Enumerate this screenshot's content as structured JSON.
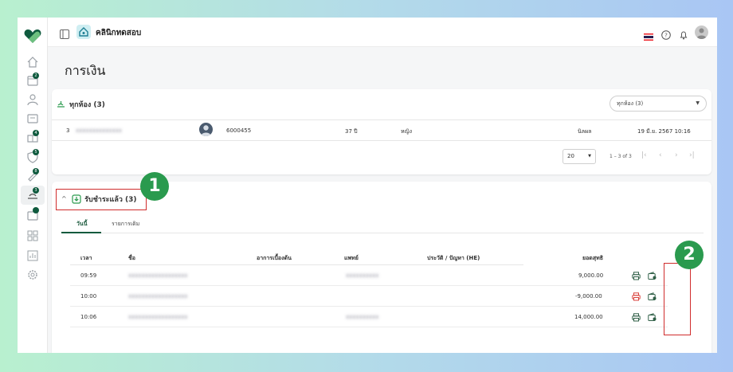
{
  "app": {
    "clinic_name": "คลินิกทดสอบ"
  },
  "page": {
    "title": "การเงิน"
  },
  "sidebar": {
    "badges": [
      "2",
      "4",
      "5",
      "8",
      "3",
      ""
    ],
    "items": [
      "home-icon",
      "appointment-icon",
      "patients-icon",
      "records-icon",
      "lab-icon",
      "shield-icon",
      "pharmacy-icon",
      "finance-icon",
      "inventory-icon",
      "apps-icon",
      "report-icon",
      "settings-icon"
    ]
  },
  "waiting_card": {
    "title": "ทุกห้อง (3)",
    "room_select": "ทุกห้อง (3)",
    "row": {
      "no": "3",
      "hn": "6000455",
      "age": "37 ปี",
      "gender": "หญิง",
      "doctor": "นิลผล",
      "datetime": "19 มี.ย. 2567 10:16"
    },
    "pager": {
      "page_size": "20",
      "range": "1 – 3 of 3"
    }
  },
  "paid_card": {
    "title": "รับชำระแล้ว (3)",
    "tabs": [
      "วันนี้",
      "รายการเดิม"
    ],
    "columns": [
      "เวลา",
      "ชื่อ",
      "อาการเบื้องต้น",
      "แพทย์",
      "ประวัติ / ปัญหา (HE)",
      "ยอดสุทธิ"
    ],
    "rows": [
      {
        "time": "09:59",
        "amount": "9,000.00",
        "status": "normal"
      },
      {
        "time": "10:00",
        "amount": "-9,000.00",
        "status": "refund"
      },
      {
        "time": "10:06",
        "amount": "14,000.00",
        "status": "normal"
      }
    ]
  },
  "callouts": [
    "1",
    "2"
  ],
  "colors": {
    "brand": "#0f5a3e",
    "callout": "#2a9a4e",
    "highlight": "#d02c2c",
    "refund": "#d9423c"
  }
}
